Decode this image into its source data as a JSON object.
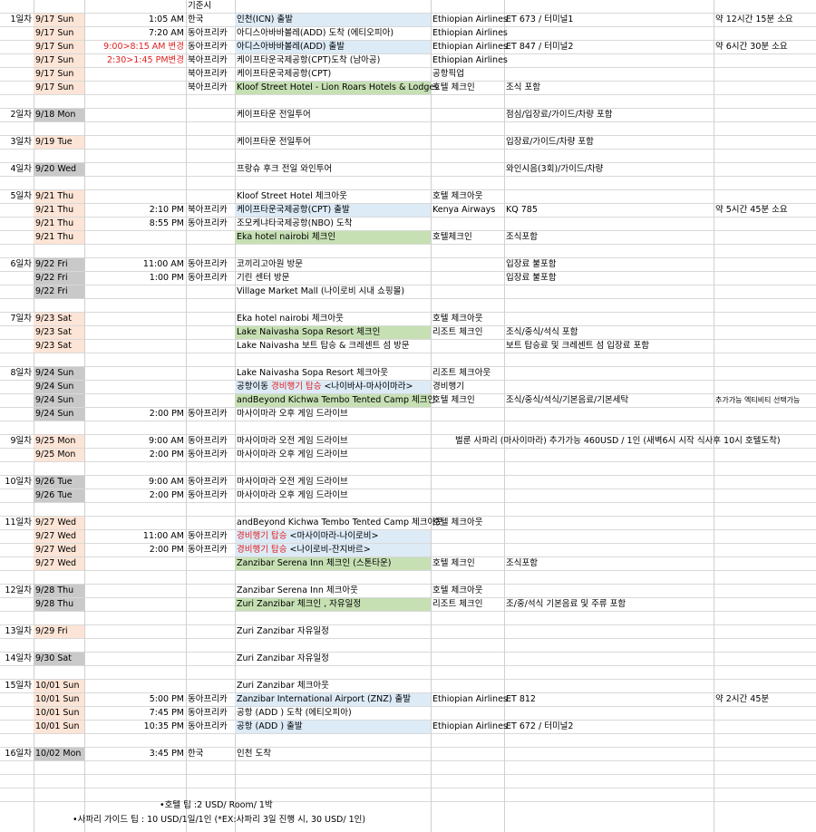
{
  "header": {
    "basis_label": "기준시"
  },
  "rows": [
    {
      "day": "1일차",
      "date": "9/17 Sun",
      "dbg": "peach",
      "time": "1:05 AM",
      "region": "한국",
      "activity": "인천(ICN) 출발",
      "act_hl": "blue",
      "col7": "Ethiopian Airlines",
      "col8": "ET 673 / 터미널1",
      "col9": "약 12시간 15분 소요"
    },
    {
      "date": "9/17 Sun",
      "dbg": "peach",
      "time": "7:20 AM",
      "region": "동아프리카",
      "activity": "아디스아바바볼레(ADD) 도착 (에티오피아)",
      "col7": "Ethiopian Airlines"
    },
    {
      "date": "9/17 Sun",
      "dbg": "peach",
      "time": "9:00>8:15 AM 변경",
      "time_red": true,
      "region": "동아프리카",
      "activity": "아디스아바바볼레(ADD) 출발",
      "act_hl": "blue",
      "col7": "Ethiopian Airlines",
      "col8": "ET 847 / 터미널2",
      "col9": "약 6시간 30분 소요"
    },
    {
      "date": "9/17 Sun",
      "dbg": "peach",
      "time": "2:30>1:45 PM변경",
      "time_red": true,
      "region": "북아프리카",
      "activity": "케이프타운국제공항(CPT)도착 (남아공)",
      "col7": "Ethiopian Airlines"
    },
    {
      "date": "9/17 Sun",
      "dbg": "peach",
      "region": "북아프리카",
      "activity": "케이프타운국제공항(CPT)",
      "col7": "공항픽업"
    },
    {
      "date": "9/17 Sun",
      "dbg": "peach",
      "region": "북아프리카",
      "activity": " Kloof Street Hotel - Lion Roars Hotels & Lodges",
      "act_hl": "green",
      "col7": "호텔 체크인",
      "col8": "조식 포함"
    },
    {},
    {
      "day": "2일차",
      "date": "9/18 Mon",
      "dbg": "grey",
      "activity": "케이프타운 전일투어",
      "col8": "점심/입장료/가이드/차량 포함"
    },
    {},
    {
      "day": "3일차",
      "date": "9/19 Tue",
      "dbg": "peach",
      "activity": "케이프타운 전일투어",
      "col8": "입장료/가이드/차량 포함"
    },
    {},
    {
      "day": "4일차",
      "date": "9/20 Wed",
      "dbg": "grey",
      "activity": "프랑슈 후크 전일 와인투어",
      "col8": "와인시음(3회)/가이드/차량"
    },
    {},
    {
      "day": "5일차",
      "date": "9/21 Thu",
      "dbg": "peach",
      "activity": " Kloof Street Hotel 체크아웃",
      "col7": "호텔 체크아웃"
    },
    {
      "date": "9/21 Thu",
      "dbg": "peach",
      "time": "2:10 PM",
      "region": "북아프리카",
      "activity": "케이프타운국제공항(CPT) 출발",
      "act_hl": "blue",
      "col7": "Kenya Airways",
      "col8": "KQ 785",
      "col9": "약 5시간 45분 소요"
    },
    {
      "date": "9/21 Thu",
      "dbg": "peach",
      "time": "8:55 PM",
      "region": "동아프리카",
      "activity": "조모케냐타국제공항(NBO) 도착"
    },
    {
      "date": "9/21 Thu",
      "dbg": "peach",
      "activity": "Eka hotel nairobi 체크인",
      "act_hl": "green",
      "col7": "호텔체크인",
      "col8": "조식포함"
    },
    {},
    {
      "day": "6일차",
      "date": "9/22 Fri",
      "dbg": "grey",
      "time": "11:00 AM",
      "region": "동아프리카",
      "activity": "코끼리고아원 방문",
      "col8": "입장료 불포함"
    },
    {
      "date": "9/22 Fri",
      "dbg": "grey",
      "time": "1:00 PM",
      "region": "동아프리카",
      "activity": "기린 센터 방문",
      "col8": "입장료 불포함"
    },
    {
      "date": "9/22 Fri",
      "dbg": "grey",
      "activity": "Village Market Mall  (나이로비 시내 쇼핑몰)"
    },
    {},
    {
      "day": "7일차",
      "date": "9/23 Sat",
      "dbg": "peach",
      "activity": "Eka hotel nairobi 체크아웃",
      "col7": "호텔 체크아웃"
    },
    {
      "date": "9/23 Sat",
      "dbg": "peach",
      "activity": "Lake Naivasha Sopa Resort 체크인",
      "act_hl": "green",
      "col7": "리조트 체크인",
      "col8": "조식/중식/석식 포함"
    },
    {
      "date": "9/23 Sat",
      "dbg": "peach",
      "activity": "Lake Naivasha 보트 탑승 & 크레센트 섬 방문",
      "col8": "보트 탑승료 및 크레센트 섬 입장료 포함"
    },
    {},
    {
      "day": "8일차",
      "date": "9/24 Sun",
      "dbg": "grey",
      "activity": "Lake Naivasha Sopa Resort 체크아웃",
      "col7": "리조트 체크아웃"
    },
    {
      "date": "9/24 Sun",
      "dbg": "grey",
      "activity": "공항이동 ",
      "act_red": "경비행기 탑승",
      "act_tail": " <나이바샤-마사이마라>",
      "act_hl": "blue",
      "col7": "경비행기"
    },
    {
      "date": "9/24 Sun",
      "dbg": "grey",
      "activity": "andBeyond Kichwa Tembo Tented Camp 체크인",
      "act_hl": "green",
      "col7": "호텔 체크인",
      "col8": "조식/중식/석식/기본음료/기본세탁",
      "col9": "추가가능 엑티비티 선택가능",
      "col9_small": true
    },
    {
      "date": "9/24 Sun",
      "dbg": "grey",
      "time": "2:00 PM",
      "region": "동아프리카",
      "activity": "마사이마라 오후 게임 드라이브"
    },
    {},
    {
      "day": "9일차",
      "date": "9/25 Mon",
      "dbg": "peach",
      "time": "9:00 AM",
      "region": "동아프리카",
      "activity": "마사이마라 오전 게임 드라이브",
      "note": "벌룬 사파리 (마사이마라) 추가가능 460USD /  1인 (새벽6시 시작 식사후 10시 호텔도착)"
    },
    {
      "date": "9/25 Mon",
      "dbg": "peach",
      "time": "2:00 PM",
      "region": "동아프리카",
      "activity": "마사이마라 오후 게임 드라이브"
    },
    {},
    {
      "day": "10일차",
      "date": "9/26 Tue",
      "dbg": "grey",
      "time": "9:00 AM",
      "region": "동아프리카",
      "activity": "마사이마라 오전 게임 드라이브"
    },
    {
      "date": "9/26 Tue",
      "dbg": "grey",
      "time": "2:00 PM",
      "region": "동아프리카",
      "activity": "마사이마라 오후 게임 드라이브"
    },
    {},
    {
      "day": "11일차",
      "date": "9/27 Wed",
      "dbg": "peach",
      "activity": "andBeyond Kichwa Tembo Tented Camp 체크아웃",
      "col7": "호텔 체크아웃"
    },
    {
      "date": "9/27 Wed",
      "dbg": "peach",
      "time": "11:00 AM",
      "region": "동아프리카",
      "activity": "",
      "act_red": "경비행기 탑승",
      "act_tail": " <마사이마라-나이로비>",
      "act_hl": "blue"
    },
    {
      "date": "9/27 Wed",
      "dbg": "peach",
      "time": "2:00 PM",
      "region": "동아프리카",
      "activity": "",
      "act_red": "경비행기 탑승",
      "act_tail": " <나이로비-잔지바르>",
      "act_hl": "blue"
    },
    {
      "date": "9/27 Wed",
      "dbg": "peach",
      "activity": "Zanzibar Serena Inn 체크인 (스톤타운)",
      "act_hl": "green",
      "col7": "호텔 체크인",
      "col8": "조식포함"
    },
    {},
    {
      "day": "12일차",
      "date": "9/28 Thu",
      "dbg": "grey",
      "activity": "Zanzibar Serena Inn 체크아웃",
      "col7": "호텔 체크아웃"
    },
    {
      "date": "9/28 Thu",
      "dbg": "grey",
      "activity": "Zuri Zanzibar 체크인 , 자유일정",
      "act_hl": "green",
      "col7": "리조트 체크인",
      "col8": "조/중/석식 기본음료 및 주류 포함"
    },
    {},
    {
      "day": "13일차",
      "date": "9/29 Fri",
      "dbg": "peach",
      "activity": "Zuri Zanzibar  자유일정"
    },
    {},
    {
      "day": "14일차",
      "date": "9/30 Sat",
      "dbg": "grey",
      "activity": "Zuri Zanzibar  자유일정"
    },
    {},
    {
      "day": "15일차",
      "date": "10/01 Sun",
      "dbg": "peach",
      "activity": "Zuri Zanzibar 체크아웃"
    },
    {
      "date": "10/01 Sun",
      "dbg": "peach",
      "time": "5:00 PM",
      "region": "동아프리카",
      "activity": "Zanzibar International Airport (ZNZ) 출발",
      "act_hl": "blue",
      "col7": "Ethiopian Airlines",
      "col8": "ET 812",
      "col9": "약 2시간 45분"
    },
    {
      "date": "10/01 Sun",
      "dbg": "peach",
      "time": "7:45 PM",
      "region": "동아프리카",
      "activity": "공항 (ADD ) 도착 (에티오피아)"
    },
    {
      "date": "10/01 Sun",
      "dbg": "peach",
      "time": "10:35 PM",
      "region": "동아프리카",
      "activity": "공항 (ADD ) 출발",
      "act_hl": "blue",
      "col7": "Ethiopian Airlines",
      "col8": "ET 672 / 터미널2"
    },
    {},
    {
      "day": "16일차",
      "date": "10/02 Mon",
      "dbg": "grey",
      "time": "3:45 PM",
      "region": "한국",
      "activity": "인천 도착"
    },
    {},
    {}
  ],
  "footer": {
    "hotel_tip": "•호텔 팁 :2 USD/ Room/ 1박",
    "guide_tip": "•사파리 가이드 팁 : 10 USD/1일/1인 (*EX:사파리 3일 진행 시, 30 USD/ 1인)"
  }
}
